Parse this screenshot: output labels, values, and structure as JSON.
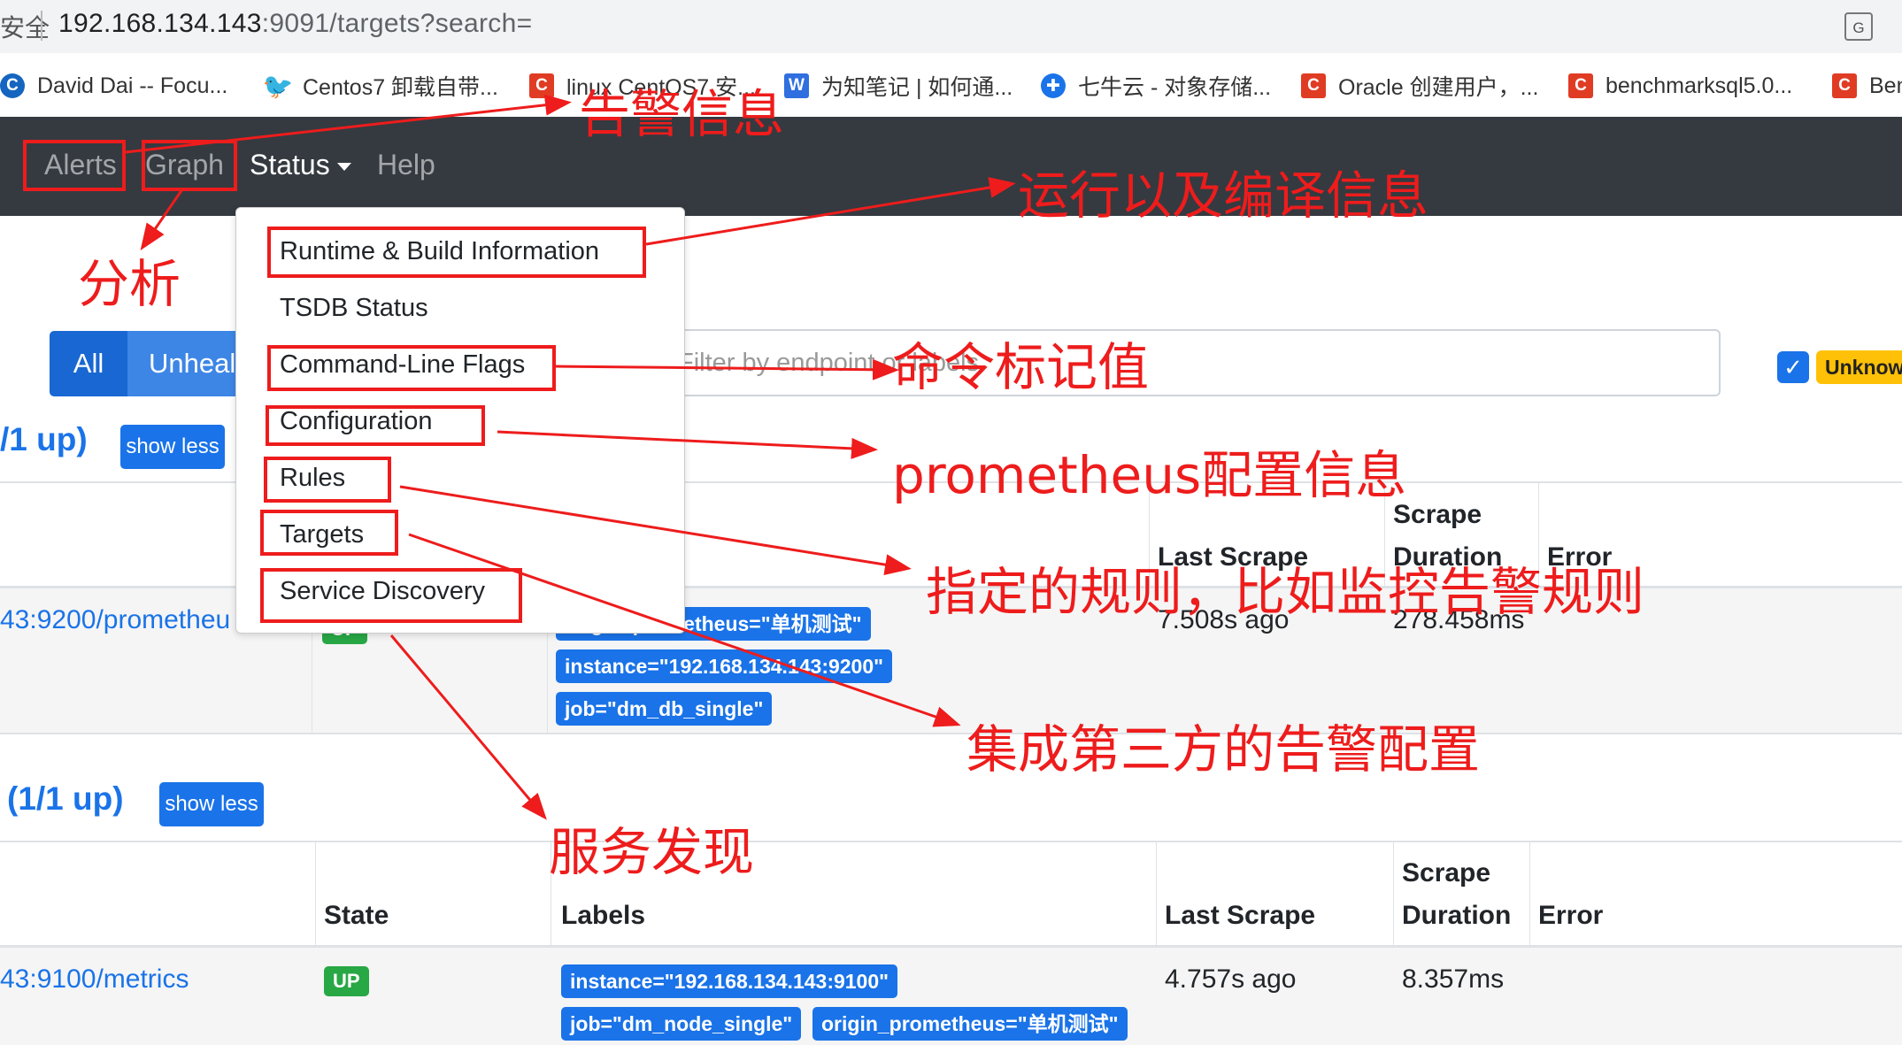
{
  "browser": {
    "address_security": "安全",
    "url_host": "192.168.134.143",
    "url_rest": ":9091/targets?search=",
    "translate_icon": "translate-icon"
  },
  "bookmarks": [
    {
      "icon": "C",
      "label": "David Dai -- Focu..."
    },
    {
      "icon": "🐦",
      "label": "Centos7 卸载自带..."
    },
    {
      "icon": "C",
      "label": "linux CentOS7 安..."
    },
    {
      "icon": "W",
      "label": "为知笔记 | 如何通..."
    },
    {
      "icon": "✚",
      "label": "七牛云 - 对象存储..."
    },
    {
      "icon": "C",
      "label": "Oracle 创建用户，..."
    },
    {
      "icon": "C",
      "label": "benchmarksql5.0..."
    },
    {
      "icon": "C",
      "label": "Ben"
    }
  ],
  "navbar": {
    "alerts": "Alerts",
    "graph": "Graph",
    "status": "Status",
    "help": "Help"
  },
  "dropdown": {
    "items": [
      "Runtime & Build Information",
      "TSDB Status",
      "Command-Line Flags",
      "Configuration",
      "Rules",
      "Targets",
      "Service Discovery"
    ]
  },
  "filters": {
    "all": "All",
    "unhealthy": "Unheal",
    "search_placeholder": "Filter by endpoint or labels",
    "unknown_badge": "Unknow"
  },
  "sections": [
    {
      "count": "/1 up)",
      "show_less": "show less",
      "headers": {
        "scrape": "Scrape",
        "duration": "Duration",
        "last_scrape": "Last Scrape",
        "error": "Error"
      },
      "row": {
        "endpoint": "43:9200/prometheu",
        "state": "UP",
        "labels": [
          "origin_prometheus=\"单机测试\"",
          "instance=\"192.168.134.143:9200\"",
          "job=\"dm_db_single\""
        ],
        "last_scrape": "7.508s ago",
        "duration": "278.458ms"
      }
    },
    {
      "count": "(1/1 up)",
      "show_less": "show less",
      "headers": {
        "state": "State",
        "labels": "Labels",
        "last_scrape": "Last Scrape",
        "scrape": "Scrape",
        "duration": "Duration",
        "error": "Error"
      },
      "row": {
        "endpoint": "43:9100/metrics",
        "state": "UP",
        "labels": [
          "instance=\"192.168.134.143:9100\"",
          "job=\"dm_node_single\"",
          "origin_prometheus=\"单机测试\""
        ],
        "last_scrape": "4.757s ago",
        "duration": "8.357ms"
      }
    }
  ],
  "annotations": {
    "alerts": "告警信息",
    "graph": "分析",
    "runtime": "运行以及编译信息",
    "flags": "命令标记值",
    "config": "prometheus配置信息",
    "rules": "指定的规则，比如监控告警规则",
    "targets": "集成第三方的告警配置",
    "service_discovery": "服务发现"
  },
  "colors": {
    "annotation_red": "#ee1c1c",
    "navbar": "#343a40",
    "primary": "#1a73e8",
    "up": "#28a745",
    "unknown": "#ffc107"
  }
}
